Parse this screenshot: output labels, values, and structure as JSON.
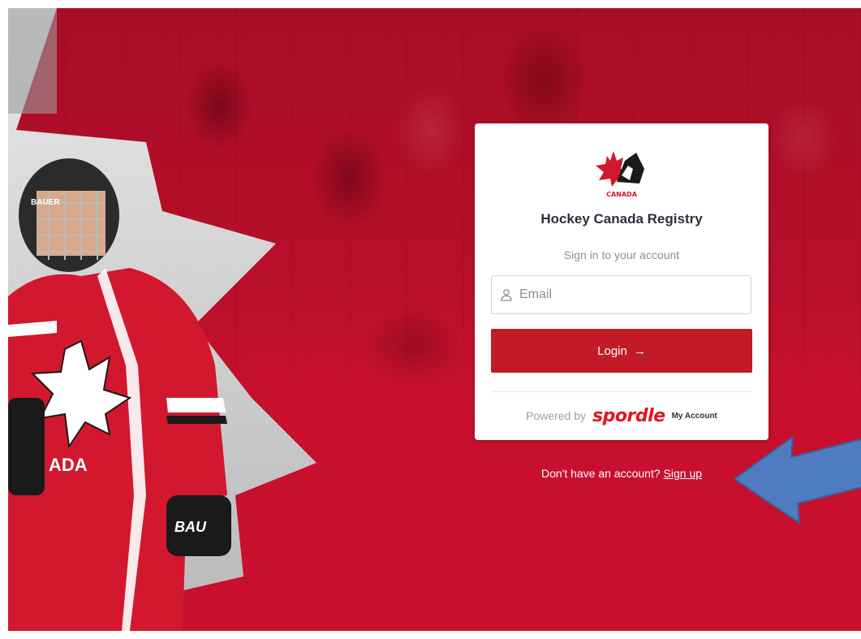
{
  "brand": {
    "logo_text": "CANADA",
    "jersey_text": "ADA",
    "helmet_brand": "BAUER",
    "glove_brand": "BAU"
  },
  "card": {
    "title": "Hockey Canada Registry",
    "subtitle": "Sign in to your account",
    "email_placeholder": "Email",
    "email_value": "",
    "login_label": "Login",
    "login_arrow": "→",
    "powered_by_label": "Powered by",
    "spordle_logo_text": "spordle",
    "my_account_label": "My Account"
  },
  "signup": {
    "prompt": "Don't have an account?",
    "link_label": "Sign up"
  },
  "colors": {
    "background_red": "#c8102e",
    "login_button": "#c21b27",
    "spordle_red": "#e4151f",
    "annotation_arrow": "#4f7cc0"
  },
  "icons": {
    "email_field": "user-icon",
    "annotation": "arrow-left-icon"
  }
}
